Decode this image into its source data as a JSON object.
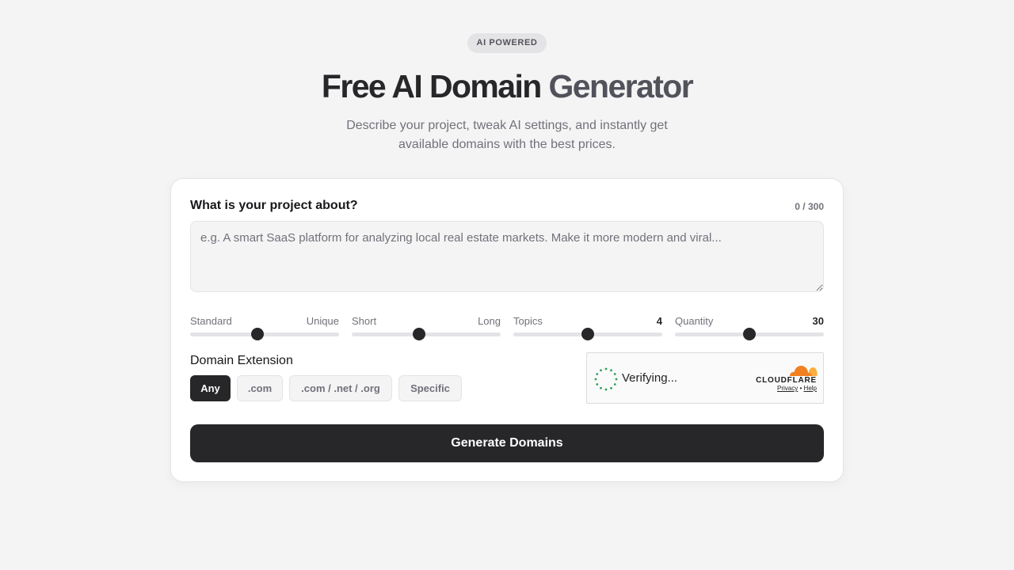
{
  "header": {
    "badge": "AI POWERED",
    "title_part1": "Free AI Domain",
    "title_part2": "Generator",
    "subtitle": "Describe your project, tweak AI settings, and instantly get available domains with the best prices."
  },
  "form": {
    "project_label": "What is your project about?",
    "char_counter": "0 / 300",
    "project_value": "",
    "project_placeholder": "e.g. A smart SaaS platform for analyzing local real estate markets. Make it more modern and viral...",
    "sliders": [
      {
        "left_label": "Standard",
        "right_label": "Unique",
        "level": 0.45
      },
      {
        "left_label": "Short",
        "right_label": "Long",
        "level": 0.45
      },
      {
        "left_label": "Topics",
        "right_label": "4",
        "level": 0.5
      },
      {
        "left_label": "Quantity",
        "right_label": "30",
        "level": 0.5
      }
    ],
    "extension_label": "Domain Extension",
    "extensions": [
      {
        "label": "Any",
        "active": true
      },
      {
        "label": ".com",
        "active": false
      },
      {
        "label": ".com / .net / .org",
        "active": false
      },
      {
        "label": "Specific",
        "active": false
      }
    ],
    "generate_label": "Generate Domains"
  },
  "captcha": {
    "status": "Verifying...",
    "brand": "CLOUDFLARE",
    "privacy": "Privacy",
    "separator": "•",
    "help": "Help"
  },
  "colors": {
    "primary": "#27272a",
    "background": "#f4f4f5",
    "muted_text": "#71717a",
    "spinner": "#2e9e5b",
    "cloudflare_orange": "#f38020"
  },
  "icons": {
    "spinner": "loading-spinner-icon",
    "cloudflare": "cloudflare-cloud-icon"
  }
}
